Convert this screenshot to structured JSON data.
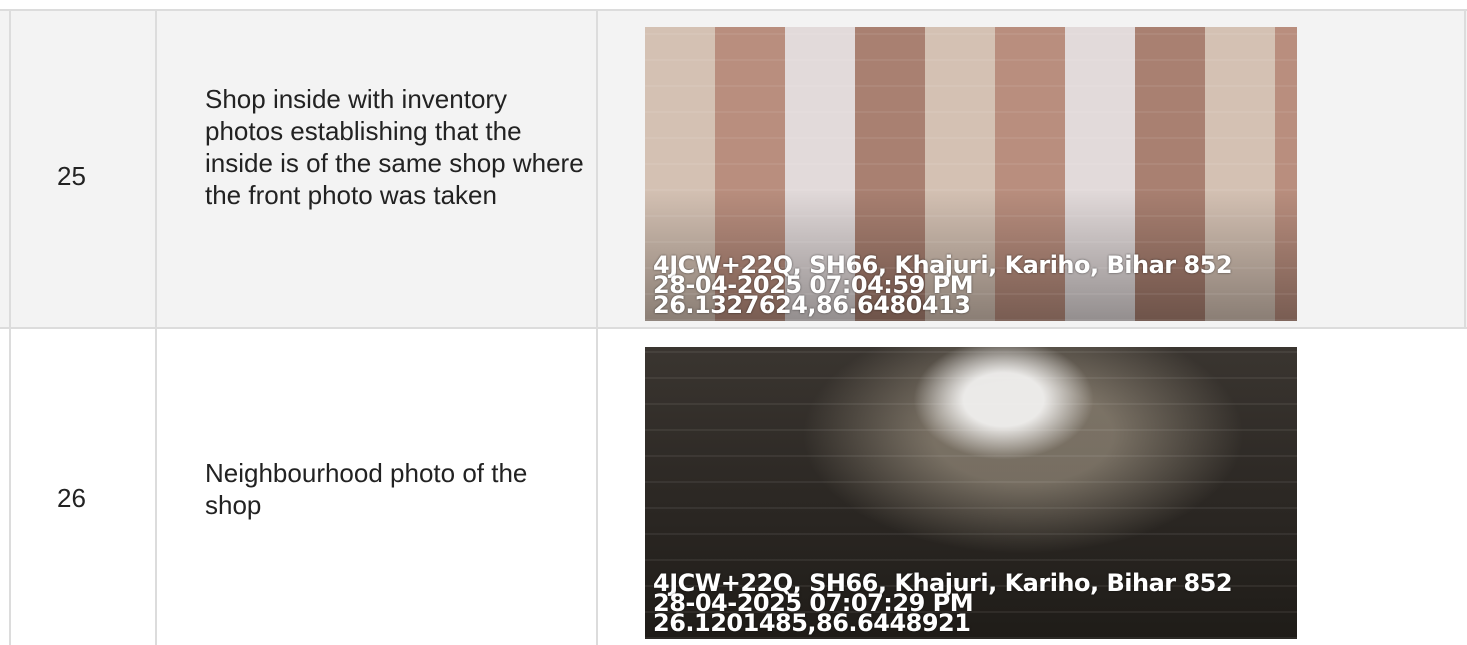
{
  "rows": [
    {
      "number": "25",
      "description": "Shop inside with inventory photos establishing that the inside is of the same shop where the front photo was taken",
      "photo_icon": "shop-inside-photo",
      "photo_overlay": {
        "address": "4JCW+22Q, SH66, Khajuri, Kariho, Bihar 852",
        "datetime": "28-04-2025 07:04:59 PM",
        "coordinates": "26.1327624,86.6480413"
      }
    },
    {
      "number": "26",
      "description": "Neighbourhood photo of the shop",
      "photo_icon": "neighbourhood-photo",
      "photo_overlay": {
        "address": "4JCW+22Q, SH66, Khajuri, Kariho, Bihar 852",
        "datetime": "28-04-2025 07:07:29 PM",
        "coordinates": "26.1201485,86.6448921"
      }
    }
  ],
  "colors": {
    "row_alt_background": "#f3f3f3",
    "grid_line": "#dcdcdc",
    "text": "#222222",
    "overlay_text": "#ffffff"
  }
}
